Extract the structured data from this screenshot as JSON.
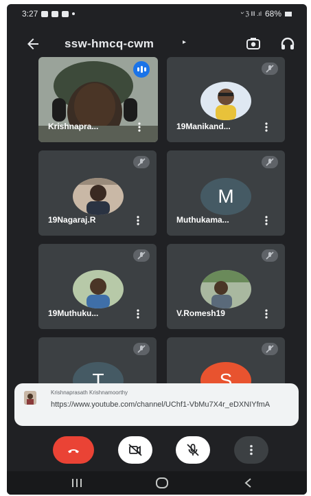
{
  "status_bar": {
    "time": "3:27",
    "battery": "68%",
    "status_icons_text": "৺ ℨ lll .ıl"
  },
  "header": {
    "meeting_code": "ssw-hmcq-cwm",
    "caret": "▸"
  },
  "participants": [
    {
      "name": "Krishnapra...",
      "speaking": true,
      "type": "camera"
    },
    {
      "name": "19Manikand...",
      "muted": true,
      "type": "photo"
    },
    {
      "name": "19Nagaraj.R",
      "muted": true,
      "type": "photo"
    },
    {
      "name": "Muthukama...",
      "muted": true,
      "type": "letter",
      "initial": "M"
    },
    {
      "name": "19Muthuku...",
      "muted": true,
      "type": "photo"
    },
    {
      "name": "V.Romesh19",
      "muted": true,
      "type": "photo"
    },
    {
      "name": "",
      "muted": true,
      "type": "letter",
      "initial": "T"
    },
    {
      "name": "",
      "muted": true,
      "type": "letter",
      "initial": "S"
    }
  ],
  "chat_toast": {
    "sender": "Krishnaprasath Krishnamoorthy",
    "message": "https://www.youtube.com/channel/UChf1-VbMu7X4r_eDXNIYfmA"
  },
  "controls": [
    "end-call",
    "camera-off",
    "mic-off",
    "more-options"
  ],
  "colors": {
    "background": "#202124",
    "tile": "#3c4043",
    "end_call": "#ea4335",
    "speaking": "#1a73e8",
    "letter_avatar": "#455a64"
  }
}
